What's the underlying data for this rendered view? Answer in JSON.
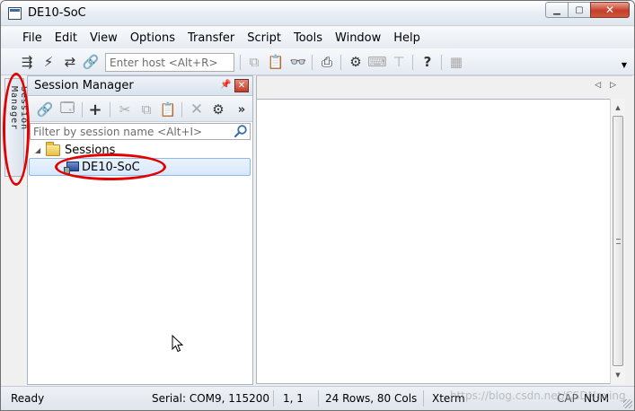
{
  "window": {
    "title": "DE10-SoC"
  },
  "menu": [
    "File",
    "Edit",
    "View",
    "Options",
    "Transfer",
    "Script",
    "Tools",
    "Window",
    "Help"
  ],
  "toolbar": {
    "host_placeholder": "Enter host <Alt+R>"
  },
  "side_tab": {
    "label": "Session Manager"
  },
  "session_manager": {
    "title": "Session Manager",
    "filter_placeholder": "Filter by session name <Alt+I>",
    "more_label": "»",
    "tree": {
      "folder": "Sessions",
      "sessions": [
        "DE10-SoC"
      ]
    }
  },
  "status": {
    "ready": "Ready",
    "serial": "Serial: COM9, 115200",
    "position": "1,  1",
    "size": "24 Rows, 80 Cols",
    "terminal": "Xterm",
    "cap": "CAP",
    "num": "NUM",
    "watermark": "https://blog.csdn.net/CSDNaxing"
  },
  "colors": {
    "annotation": "#e30000",
    "selection": "#d7e7fa",
    "panel_close": "#c23c28"
  }
}
